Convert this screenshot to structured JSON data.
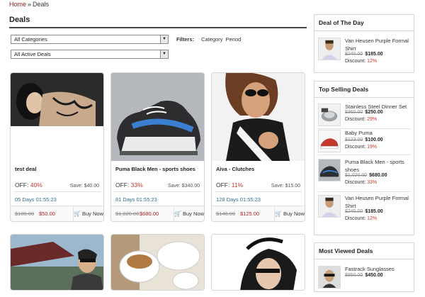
{
  "breadcrumb": {
    "home": "Home",
    "sep": "»",
    "current": "Deals"
  },
  "deals": {
    "title": "Deals",
    "category_select": "All Categories",
    "status_select": "All Active Deals",
    "filters_label": "Filters:",
    "filter_options": [
      "Category",
      "Period"
    ]
  },
  "cards": [
    {
      "name": "test deal",
      "off_label": "OFF:",
      "off_pct": "40%",
      "save": "Save: $40.00",
      "timer": "05 Days 01:55:23",
      "old": "$100.00",
      "new": "$50.00",
      "buy": "Buy Now"
    },
    {
      "name": "Puma Black Men - sports shoes",
      "off_label": "OFF:",
      "off_pct": "33%",
      "save": "Save: $340.00",
      "timer": "81 Days 01:55:23",
      "old": "$1,020.00",
      "new": "$680.00",
      "buy": "Buy Now"
    },
    {
      "name": "Aiva - Clutches",
      "off_label": "OFF:",
      "off_pct": "11%",
      "save": "Save: $15.00",
      "timer": "128 Days 01:55:23",
      "old": "$140.00",
      "new": "$125.00",
      "buy": "Buy Now"
    }
  ],
  "sidebar": {
    "deal_of_day": {
      "title": "Deal of The Day",
      "items": [
        {
          "name": "Van Heusen Purple Formal Shirt",
          "old": "$240.00",
          "new": "$185.00",
          "discount_label": "Discount:",
          "discount": "12%"
        }
      ]
    },
    "top_selling": {
      "title": "Top Selling Deals",
      "items": [
        {
          "name": "Stainless Steel Dinner Set",
          "old": "$360.00",
          "new": "$250.00",
          "discount_label": "Discount:",
          "discount": "29%"
        },
        {
          "name": "Baby Puma",
          "old": "$123.00",
          "new": "$100.00",
          "discount_label": "Discount:",
          "discount": "19%"
        },
        {
          "name": "Puma Black Men - sports shoes",
          "old": "$1,020.00",
          "new": "$680.00",
          "discount_label": "Discount:",
          "discount": "33%"
        },
        {
          "name": "Van Heusen Purple Formal Shirt",
          "old": "$240.00",
          "new": "$185.00",
          "discount_label": "Discount:",
          "discount": "12%"
        }
      ]
    },
    "most_viewed": {
      "title": "Most Viewed Deals",
      "items": [
        {
          "name": "Fastrack Sunglasses",
          "old": "$850.00",
          "new": "$450.00"
        }
      ]
    }
  },
  "icons": {
    "cart": "cart-icon",
    "dropdown": "chevron-down-icon"
  },
  "colors": {
    "link_red": "#8b1c1c",
    "pct_red": "#c0392b",
    "timer_blue": "#2e6e8e"
  }
}
